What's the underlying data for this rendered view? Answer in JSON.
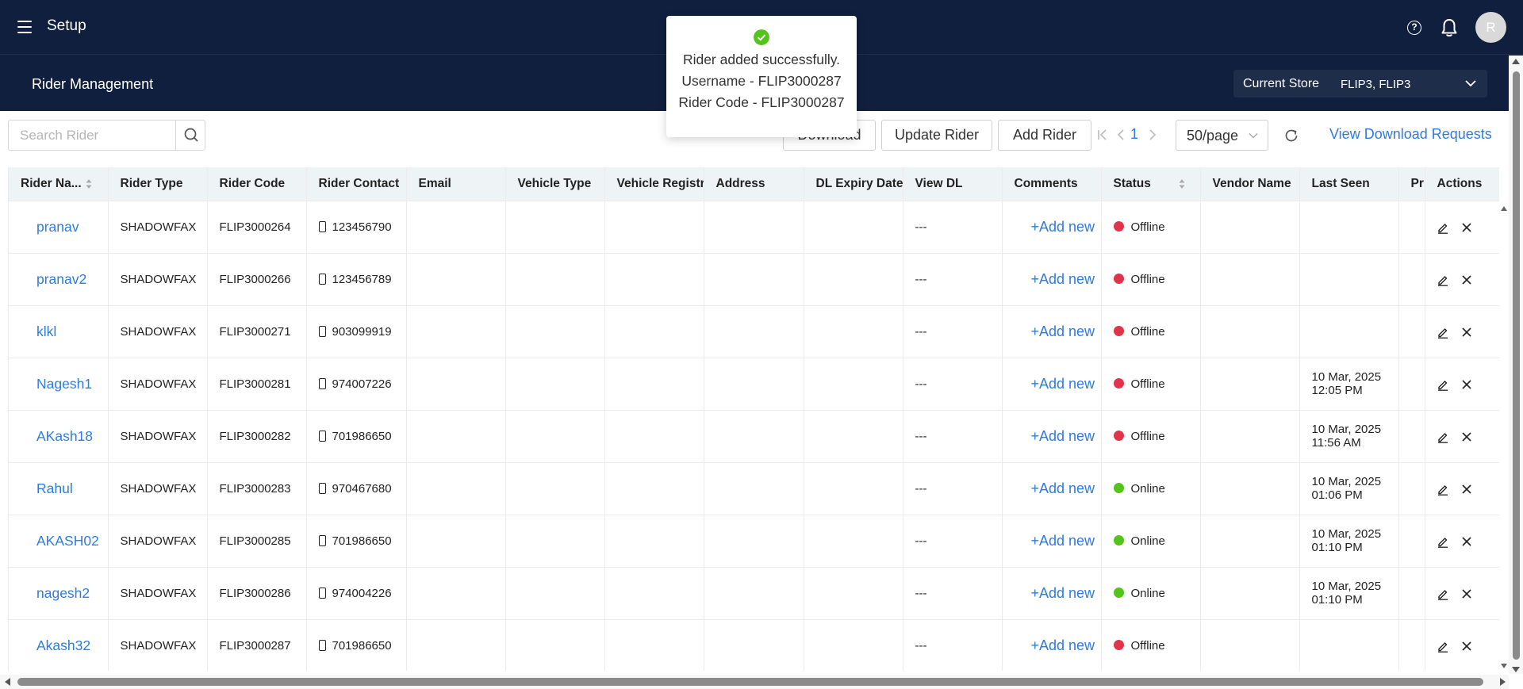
{
  "topbar": {
    "title": "Setup",
    "help_icon": "question-circle-icon",
    "bell_icon": "bell-icon",
    "avatar_initial": "R"
  },
  "subheader": {
    "page_title": "Rider Management",
    "store_label": "Current Store",
    "store_value": "FLIP3, FLIP3"
  },
  "toolbar": {
    "search_placeholder": "Search Rider",
    "download_label": "Download",
    "update_rider_label": "Update Rider",
    "add_rider_label": "Add Rider",
    "current_page": "1",
    "page_size": "50/page",
    "view_requests_label": "View Download Requests"
  },
  "toast": {
    "line1": "Rider added successfully.",
    "line2": "Username - FLIP3000287",
    "line3": "Rider Code - FLIP3000287"
  },
  "table": {
    "headers": [
      "Rider Na...",
      "Rider Type",
      "Rider Code",
      "Rider Contact",
      "Email",
      "Vehicle Type",
      "Vehicle Registrati",
      "Address",
      "DL Expiry Date",
      "View DL",
      "Comments",
      "Status",
      "Vendor Name",
      "Last Seen",
      "Pr",
      "Actions"
    ],
    "rows": [
      {
        "name": "pranav",
        "type": "SHADOWFAX",
        "code": "FLIP3000264",
        "contact": "123456790",
        "view_dl": "---",
        "comment": "+Add new",
        "status": "Offline",
        "last_seen_date": "",
        "last_seen_time": ""
      },
      {
        "name": "pranav2",
        "type": "SHADOWFAX",
        "code": "FLIP3000266",
        "contact": "123456789",
        "view_dl": "---",
        "comment": "+Add new",
        "status": "Offline",
        "last_seen_date": "",
        "last_seen_time": ""
      },
      {
        "name": "klkl",
        "type": "SHADOWFAX",
        "code": "FLIP3000271",
        "contact": "903099919",
        "view_dl": "---",
        "comment": "+Add new",
        "status": "Offline",
        "last_seen_date": "",
        "last_seen_time": ""
      },
      {
        "name": "Nagesh1",
        "type": "SHADOWFAX",
        "code": "FLIP3000281",
        "contact": "974007226",
        "view_dl": "---",
        "comment": "+Add new",
        "status": "Offline",
        "last_seen_date": "10 Mar, 2025",
        "last_seen_time": "12:05 PM"
      },
      {
        "name": "AKash18",
        "type": "SHADOWFAX",
        "code": "FLIP3000282",
        "contact": "701986650",
        "view_dl": "---",
        "comment": "+Add new",
        "status": "Offline",
        "last_seen_date": "10 Mar, 2025",
        "last_seen_time": "11:56 AM"
      },
      {
        "name": "Rahul",
        "type": "SHADOWFAX",
        "code": "FLIP3000283",
        "contact": "970467680",
        "view_dl": "---",
        "comment": "+Add new",
        "status": "Online",
        "last_seen_date": "10 Mar, 2025",
        "last_seen_time": "01:06 PM"
      },
      {
        "name": "AKASH02",
        "type": "SHADOWFAX",
        "code": "FLIP3000285",
        "contact": "701986650",
        "view_dl": "---",
        "comment": "+Add new",
        "status": "Online",
        "last_seen_date": "10 Mar, 2025",
        "last_seen_time": "01:10 PM"
      },
      {
        "name": "nagesh2",
        "type": "SHADOWFAX",
        "code": "FLIP3000286",
        "contact": "974004226",
        "view_dl": "---",
        "comment": "+Add new",
        "status": "Online",
        "last_seen_date": "10 Mar, 2025",
        "last_seen_time": "01:10 PM"
      },
      {
        "name": "Akash32",
        "type": "SHADOWFAX",
        "code": "FLIP3000287",
        "contact": "701986650",
        "view_dl": "---",
        "comment": "+Add new",
        "status": "Offline",
        "last_seen_date": "",
        "last_seen_time": ""
      }
    ]
  },
  "colors": {
    "header_bg": "#0f1f3d",
    "link": "#2d7be5",
    "offline": "#e0344b",
    "online": "#52c41a",
    "table_header_bg": "#eef4f6"
  }
}
